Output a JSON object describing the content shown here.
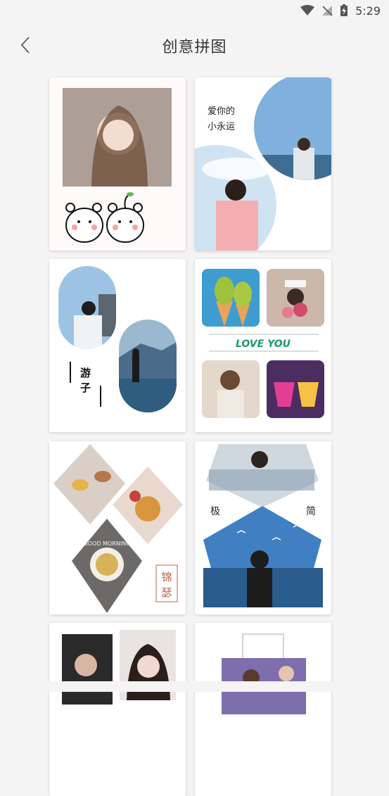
{
  "status": {
    "time": "5:29"
  },
  "header": {
    "title": "创意拼图"
  },
  "templates": [
    {
      "id": 1,
      "caption": ""
    },
    {
      "id": 2,
      "caption": "爱你的 小永运"
    },
    {
      "id": 3,
      "caption": "游子"
    },
    {
      "id": 4,
      "caption": "LOVE YOU"
    },
    {
      "id": 5,
      "caption": "锦瑟",
      "sub_caption": "GOOD MORNING"
    },
    {
      "id": 6,
      "caption_left": "极",
      "caption_right": "简"
    },
    {
      "id": 7,
      "caption": ""
    },
    {
      "id": 8,
      "caption": ""
    }
  ],
  "colors": {
    "accent_green": "#1a9a6e",
    "seal_red": "#b5644a"
  }
}
